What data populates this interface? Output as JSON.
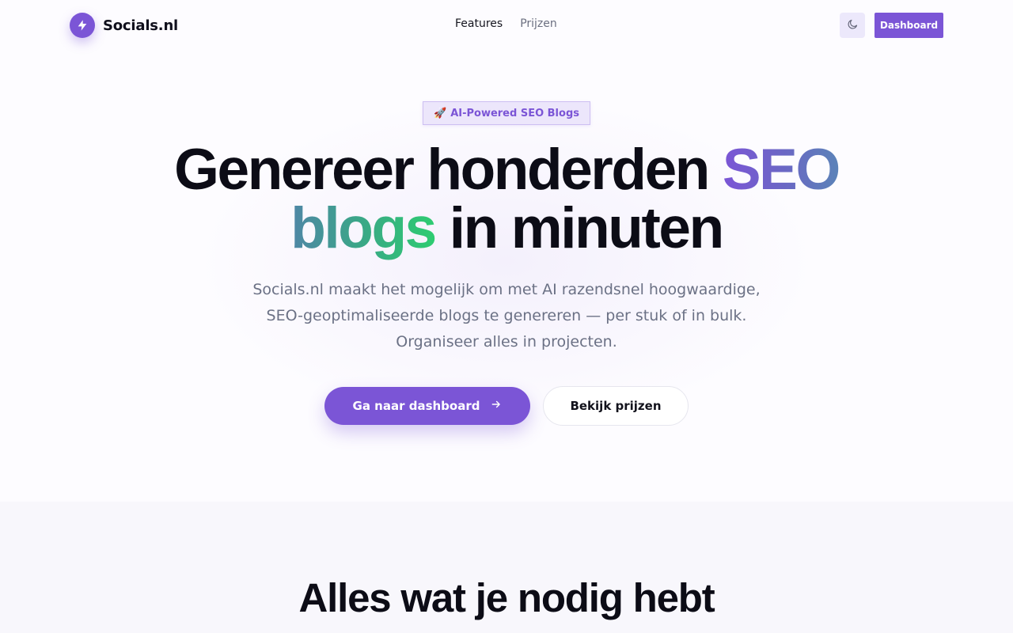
{
  "header": {
    "logo_text": "Socials.nl",
    "nav": [
      {
        "label": "Features",
        "active": true
      },
      {
        "label": "Prijzen",
        "active": false
      }
    ],
    "theme_toggle_icon": "moon-icon",
    "dashboard_label": "Dashboard"
  },
  "hero": {
    "badge_emoji": "🚀",
    "badge_text": "AI-Powered SEO Blogs",
    "headline": {
      "part1": "Genereer honderden ",
      "part2": "SEO",
      "part3": "blogs",
      "part4": " in minuten"
    },
    "subtitle_lines": [
      "Socials.nl maakt het mogelijk om met AI razendsnel hoogwaardige,",
      "SEO-geoptimaliseerde blogs te genereren — per stuk of in bulk.",
      "Organiseer alles in projecten."
    ],
    "primary_cta": "Ga naar dashboard",
    "primary_cta_icon": "arrow-right-icon",
    "secondary_cta": "Bekijk prijzen"
  },
  "features": {
    "title": "Alles wat je nodig hebt"
  },
  "colors": {
    "brand_purple": "#7b55d6",
    "gradient_green": "#2ecc71",
    "text_dark": "#0c0c16",
    "text_muted": "#6b7185"
  }
}
